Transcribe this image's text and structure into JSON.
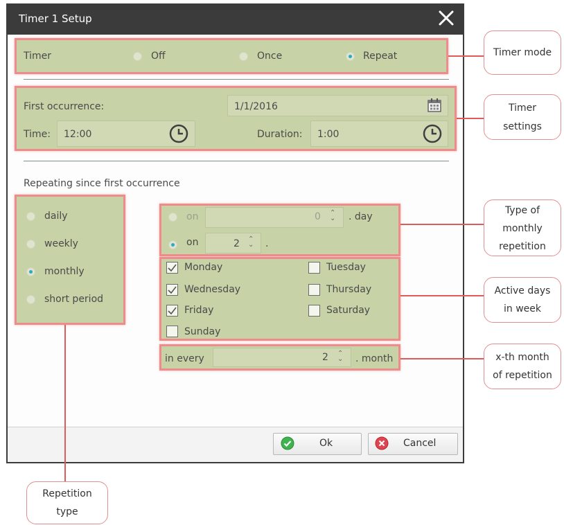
{
  "dialog": {
    "title": "Timer 1 Setup",
    "timer_mode": {
      "label": "Timer",
      "options": [
        "Off",
        "Once",
        "Repeat"
      ],
      "selected": "Repeat"
    },
    "first_occurrence": {
      "label": "First occurrence:",
      "date": "1/1/2016"
    },
    "time": {
      "label": "Time:",
      "value": "12:00"
    },
    "duration": {
      "label": "Duration:",
      "value": "1:00"
    },
    "repeating_heading": "Repeating since first occurrence",
    "repetition_type": {
      "options": [
        "daily",
        "weekly",
        "monthly",
        "short period"
      ],
      "selected": "monthly"
    },
    "monthly": {
      "option1": {
        "label": "on",
        "value": "0",
        "suffix": ". day"
      },
      "option2": {
        "label": "on",
        "value": "2",
        "suffix": "."
      },
      "selected": "option2"
    },
    "days": [
      {
        "name": "Monday",
        "checked": true
      },
      {
        "name": "Tuesday",
        "checked": false
      },
      {
        "name": "Wednesday",
        "checked": true
      },
      {
        "name": "Thursday",
        "checked": false
      },
      {
        "name": "Friday",
        "checked": true
      },
      {
        "name": "Saturday",
        "checked": false
      },
      {
        "name": "Sunday",
        "checked": false
      }
    ],
    "every": {
      "label": "in every",
      "value": "2",
      "suffix": ". month"
    },
    "buttons": {
      "ok": "Ok",
      "cancel": "Cancel"
    }
  },
  "callouts": {
    "timer_mode": "Timer mode",
    "timer_settings": [
      "Timer",
      "settings"
    ],
    "type_of_monthly": [
      "Type of",
      "monthly",
      "repetition"
    ],
    "active_days": [
      "Active days",
      "in week"
    ],
    "xth_month": [
      "x-th month",
      "of repetition"
    ],
    "repetition_type": [
      "Repetition",
      "type"
    ]
  },
  "colors": {
    "highlight_fill": "#c7d2a6",
    "highlight_border": "#ee8c8c",
    "titlebar": "#3b3b3b",
    "radio_selected": "#2fa9c7",
    "ok_icon": "#3fb34f",
    "cancel_icon": "#e0454f"
  }
}
